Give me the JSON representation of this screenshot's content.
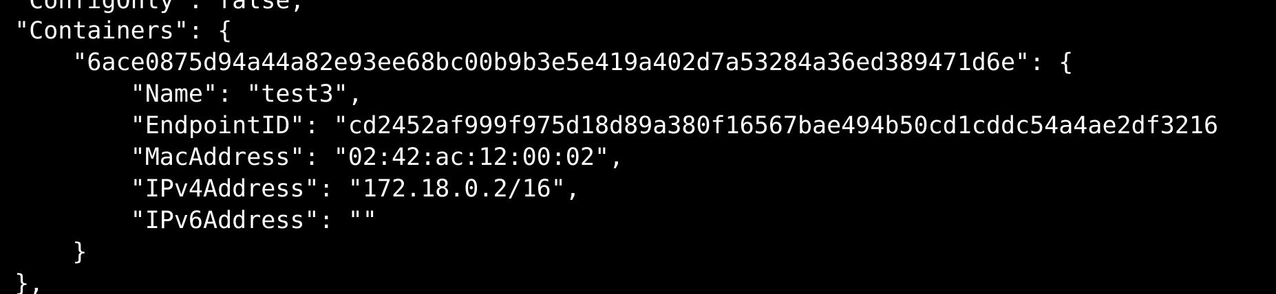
{
  "terminal": {
    "background": "#000000",
    "foreground": "#ffffff",
    "lines": [
      " \"ConfigOnly\": false,",
      " \"Containers\": {",
      "     \"6ace0875d94a44a82e93ee68bc00b9b3e5e419a402d7a53284a36ed389471d6e\": {",
      "         \"Name\": \"test3\",",
      "         \"EndpointID\": \"cd2452af999f975d18d89a380f16567bae494b50cd1cddc54a4ae2df3216",
      "         \"MacAddress\": \"02:42:ac:12:00:02\",",
      "         \"IPv4Address\": \"172.18.0.2/16\",",
      "         \"IPv6Address\": \"\"",
      "     }",
      " },"
    ]
  }
}
